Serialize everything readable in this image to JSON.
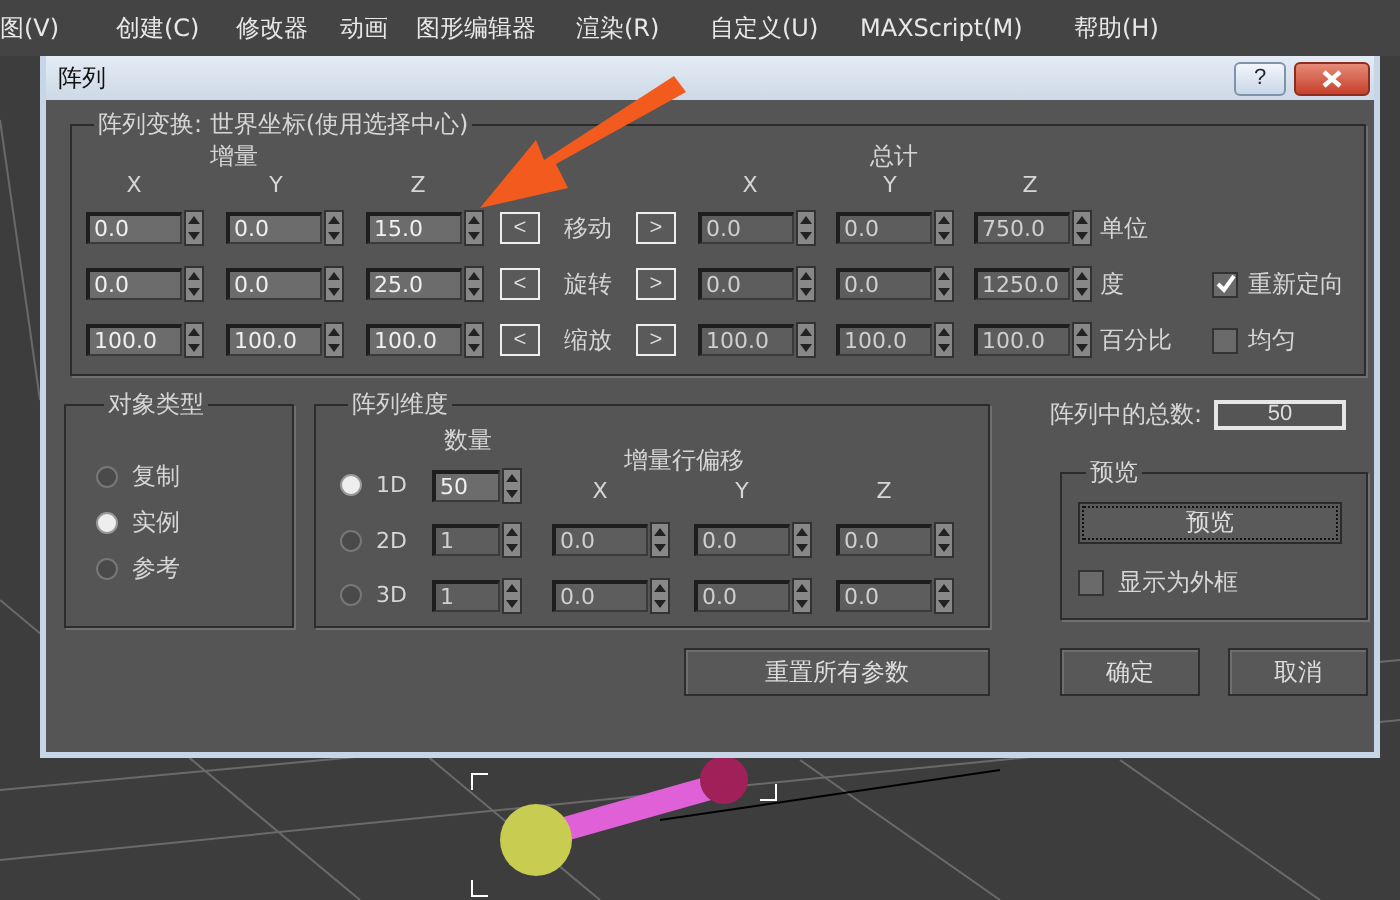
{
  "menu_bar": [
    "图(V)",
    "创建(C)",
    "修改器",
    "动画",
    "图形编辑器",
    "渲染(R)",
    "自定义(U)",
    "MAXScript(M)",
    "帮助(H)"
  ],
  "dialog": {
    "title": "阵列",
    "help_button": "?",
    "transform": {
      "title": "阵列变换: 世界坐标(使用选择中心)",
      "increment_label": "增量",
      "total_label": "总计",
      "increment_axes": [
        "X",
        "Y",
        "Z"
      ],
      "total_axes": [
        "X",
        "Y",
        "Z"
      ],
      "rows": [
        {
          "name": "移动",
          "left": "<",
          "right": ">",
          "increment": [
            "0.0",
            "0.0",
            "15.0"
          ],
          "total": [
            "0.0",
            "0.0",
            "750.0"
          ],
          "unit": "单位"
        },
        {
          "name": "旋转",
          "left": "<",
          "right": ">",
          "increment": [
            "0.0",
            "0.0",
            "25.0"
          ],
          "total": [
            "0.0",
            "0.0",
            "1250.0"
          ],
          "unit": "度",
          "option": {
            "label": "重新定向",
            "checked": true
          }
        },
        {
          "name": "缩放",
          "left": "<",
          "right": ">",
          "increment": [
            "100.0",
            "100.0",
            "100.0"
          ],
          "total": [
            "100.0",
            "100.0",
            "100.0"
          ],
          "unit": "百分比",
          "option": {
            "label": "均匀",
            "checked": false
          }
        }
      ]
    },
    "object_type": {
      "title": "对象类型",
      "options": [
        {
          "label": "复制",
          "selected": false
        },
        {
          "label": "实例",
          "selected": true
        },
        {
          "label": "参考",
          "selected": false
        }
      ]
    },
    "dimensions": {
      "title": "阵列维度",
      "count_label": "数量",
      "offset_label": "增量行偏移",
      "axes": [
        "X",
        "Y",
        "Z"
      ],
      "rows": [
        {
          "label": "1D",
          "selected": true,
          "count": "50"
        },
        {
          "label": "2D",
          "selected": false,
          "count": "1",
          "offsets": [
            "0.0",
            "0.0",
            "0.0"
          ]
        },
        {
          "label": "3D",
          "selected": false,
          "count": "1",
          "offsets": [
            "0.0",
            "0.0",
            "0.0"
          ]
        }
      ]
    },
    "total_count": {
      "label": "阵列中的总数:",
      "value": "50"
    },
    "preview": {
      "title": "预览",
      "button": "预览",
      "checkbox": {
        "label": "显示为外框",
        "checked": false
      }
    },
    "reset_button": "重置所有参数",
    "ok_button": "确定",
    "cancel_button": "取消"
  }
}
